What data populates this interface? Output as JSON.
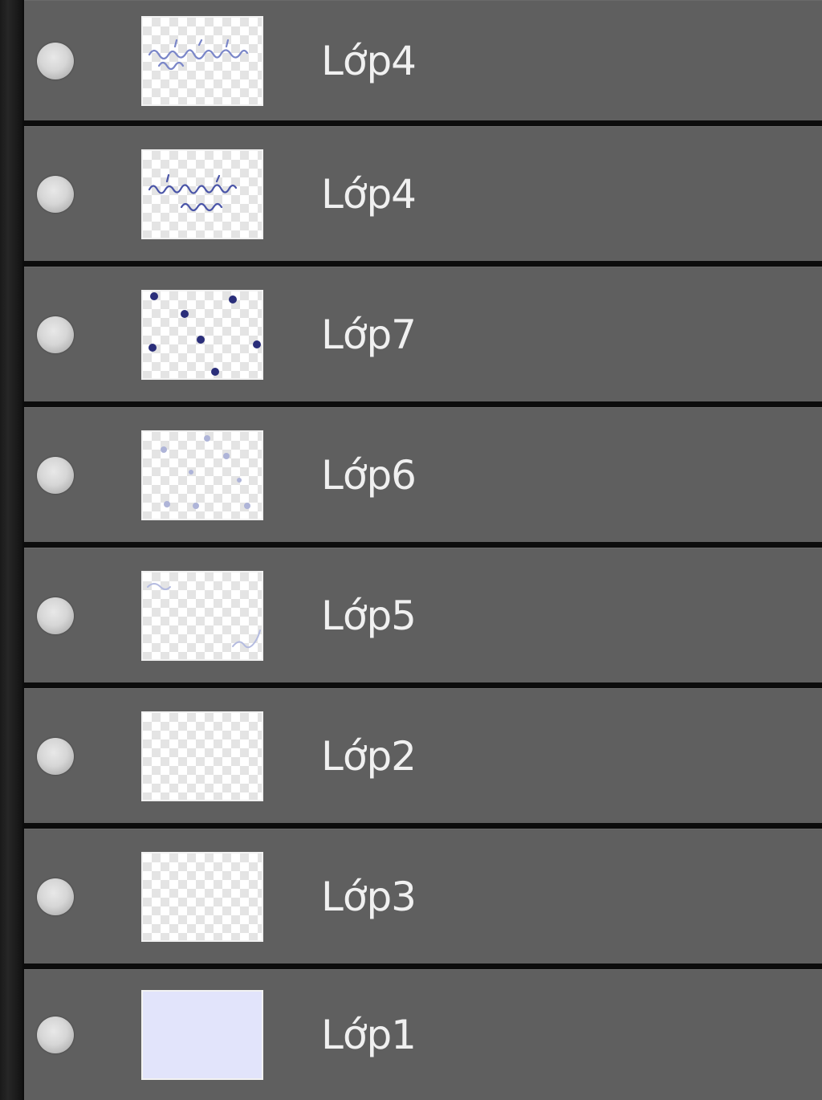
{
  "panel": {
    "title": "",
    "layers": [
      {
        "name": "Lớp4",
        "thumbnail": "handwriting-text-icon",
        "visible": true
      },
      {
        "name": "Lớp4",
        "thumbnail": "handwriting-text-two-lines-icon",
        "visible": true
      },
      {
        "name": "Lớp7",
        "thumbnail": "dots-icon",
        "visible": true
      },
      {
        "name": "Lớp6",
        "thumbnail": "faint-dots-icon",
        "visible": true
      },
      {
        "name": "Lớp5",
        "thumbnail": "corner-scribble-icon",
        "visible": true
      },
      {
        "name": "Lớp2",
        "thumbnail": "transparent-icon",
        "visible": true
      },
      {
        "name": "Lớp3",
        "thumbnail": "transparent-icon",
        "visible": true
      },
      {
        "name": "Lớp1",
        "thumbnail": "solid-fill-icon",
        "visible": true,
        "fill_color": "#e2e4fb"
      }
    ]
  },
  "colors": {
    "row_background": "#5f5f5f",
    "separator": "#0c0c0c",
    "text": "#f0f0f0",
    "ink": "#2a2e7a"
  }
}
